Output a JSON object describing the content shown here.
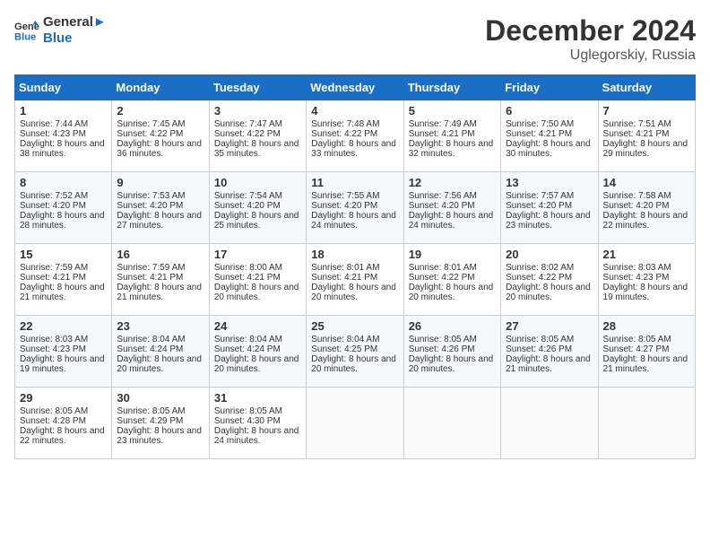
{
  "logo": {
    "line1": "General",
    "line2": "Blue"
  },
  "title": "December 2024",
  "subtitle": "Uglegorskiy, Russia",
  "days_of_week": [
    "Sunday",
    "Monday",
    "Tuesday",
    "Wednesday",
    "Thursday",
    "Friday",
    "Saturday"
  ],
  "weeks": [
    [
      {
        "day": 1,
        "sunrise": "7:44 AM",
        "sunset": "4:23 PM",
        "daylight": "8 hours and 38 minutes."
      },
      {
        "day": 2,
        "sunrise": "7:45 AM",
        "sunset": "4:22 PM",
        "daylight": "8 hours and 36 minutes."
      },
      {
        "day": 3,
        "sunrise": "7:47 AM",
        "sunset": "4:22 PM",
        "daylight": "8 hours and 35 minutes."
      },
      {
        "day": 4,
        "sunrise": "7:48 AM",
        "sunset": "4:22 PM",
        "daylight": "8 hours and 33 minutes."
      },
      {
        "day": 5,
        "sunrise": "7:49 AM",
        "sunset": "4:21 PM",
        "daylight": "8 hours and 32 minutes."
      },
      {
        "day": 6,
        "sunrise": "7:50 AM",
        "sunset": "4:21 PM",
        "daylight": "8 hours and 30 minutes."
      },
      {
        "day": 7,
        "sunrise": "7:51 AM",
        "sunset": "4:21 PM",
        "daylight": "8 hours and 29 minutes."
      }
    ],
    [
      {
        "day": 8,
        "sunrise": "7:52 AM",
        "sunset": "4:20 PM",
        "daylight": "8 hours and 28 minutes."
      },
      {
        "day": 9,
        "sunrise": "7:53 AM",
        "sunset": "4:20 PM",
        "daylight": "8 hours and 27 minutes."
      },
      {
        "day": 10,
        "sunrise": "7:54 AM",
        "sunset": "4:20 PM",
        "daylight": "8 hours and 25 minutes."
      },
      {
        "day": 11,
        "sunrise": "7:55 AM",
        "sunset": "4:20 PM",
        "daylight": "8 hours and 24 minutes."
      },
      {
        "day": 12,
        "sunrise": "7:56 AM",
        "sunset": "4:20 PM",
        "daylight": "8 hours and 24 minutes."
      },
      {
        "day": 13,
        "sunrise": "7:57 AM",
        "sunset": "4:20 PM",
        "daylight": "8 hours and 23 minutes."
      },
      {
        "day": 14,
        "sunrise": "7:58 AM",
        "sunset": "4:20 PM",
        "daylight": "8 hours and 22 minutes."
      }
    ],
    [
      {
        "day": 15,
        "sunrise": "7:59 AM",
        "sunset": "4:21 PM",
        "daylight": "8 hours and 21 minutes."
      },
      {
        "day": 16,
        "sunrise": "7:59 AM",
        "sunset": "4:21 PM",
        "daylight": "8 hours and 21 minutes."
      },
      {
        "day": 17,
        "sunrise": "8:00 AM",
        "sunset": "4:21 PM",
        "daylight": "8 hours and 20 minutes."
      },
      {
        "day": 18,
        "sunrise": "8:01 AM",
        "sunset": "4:21 PM",
        "daylight": "8 hours and 20 minutes."
      },
      {
        "day": 19,
        "sunrise": "8:01 AM",
        "sunset": "4:22 PM",
        "daylight": "8 hours and 20 minutes."
      },
      {
        "day": 20,
        "sunrise": "8:02 AM",
        "sunset": "4:22 PM",
        "daylight": "8 hours and 20 minutes."
      },
      {
        "day": 21,
        "sunrise": "8:03 AM",
        "sunset": "4:23 PM",
        "daylight": "8 hours and 19 minutes."
      }
    ],
    [
      {
        "day": 22,
        "sunrise": "8:03 AM",
        "sunset": "4:23 PM",
        "daylight": "8 hours and 19 minutes."
      },
      {
        "day": 23,
        "sunrise": "8:04 AM",
        "sunset": "4:24 PM",
        "daylight": "8 hours and 20 minutes."
      },
      {
        "day": 24,
        "sunrise": "8:04 AM",
        "sunset": "4:24 PM",
        "daylight": "8 hours and 20 minutes."
      },
      {
        "day": 25,
        "sunrise": "8:04 AM",
        "sunset": "4:25 PM",
        "daylight": "8 hours and 20 minutes."
      },
      {
        "day": 26,
        "sunrise": "8:05 AM",
        "sunset": "4:26 PM",
        "daylight": "8 hours and 20 minutes."
      },
      {
        "day": 27,
        "sunrise": "8:05 AM",
        "sunset": "4:26 PM",
        "daylight": "8 hours and 21 minutes."
      },
      {
        "day": 28,
        "sunrise": "8:05 AM",
        "sunset": "4:27 PM",
        "daylight": "8 hours and 21 minutes."
      }
    ],
    [
      {
        "day": 29,
        "sunrise": "8:05 AM",
        "sunset": "4:28 PM",
        "daylight": "8 hours and 22 minutes."
      },
      {
        "day": 30,
        "sunrise": "8:05 AM",
        "sunset": "4:29 PM",
        "daylight": "8 hours and 23 minutes."
      },
      {
        "day": 31,
        "sunrise": "8:05 AM",
        "sunset": "4:30 PM",
        "daylight": "8 hours and 24 minutes."
      },
      null,
      null,
      null,
      null
    ]
  ]
}
